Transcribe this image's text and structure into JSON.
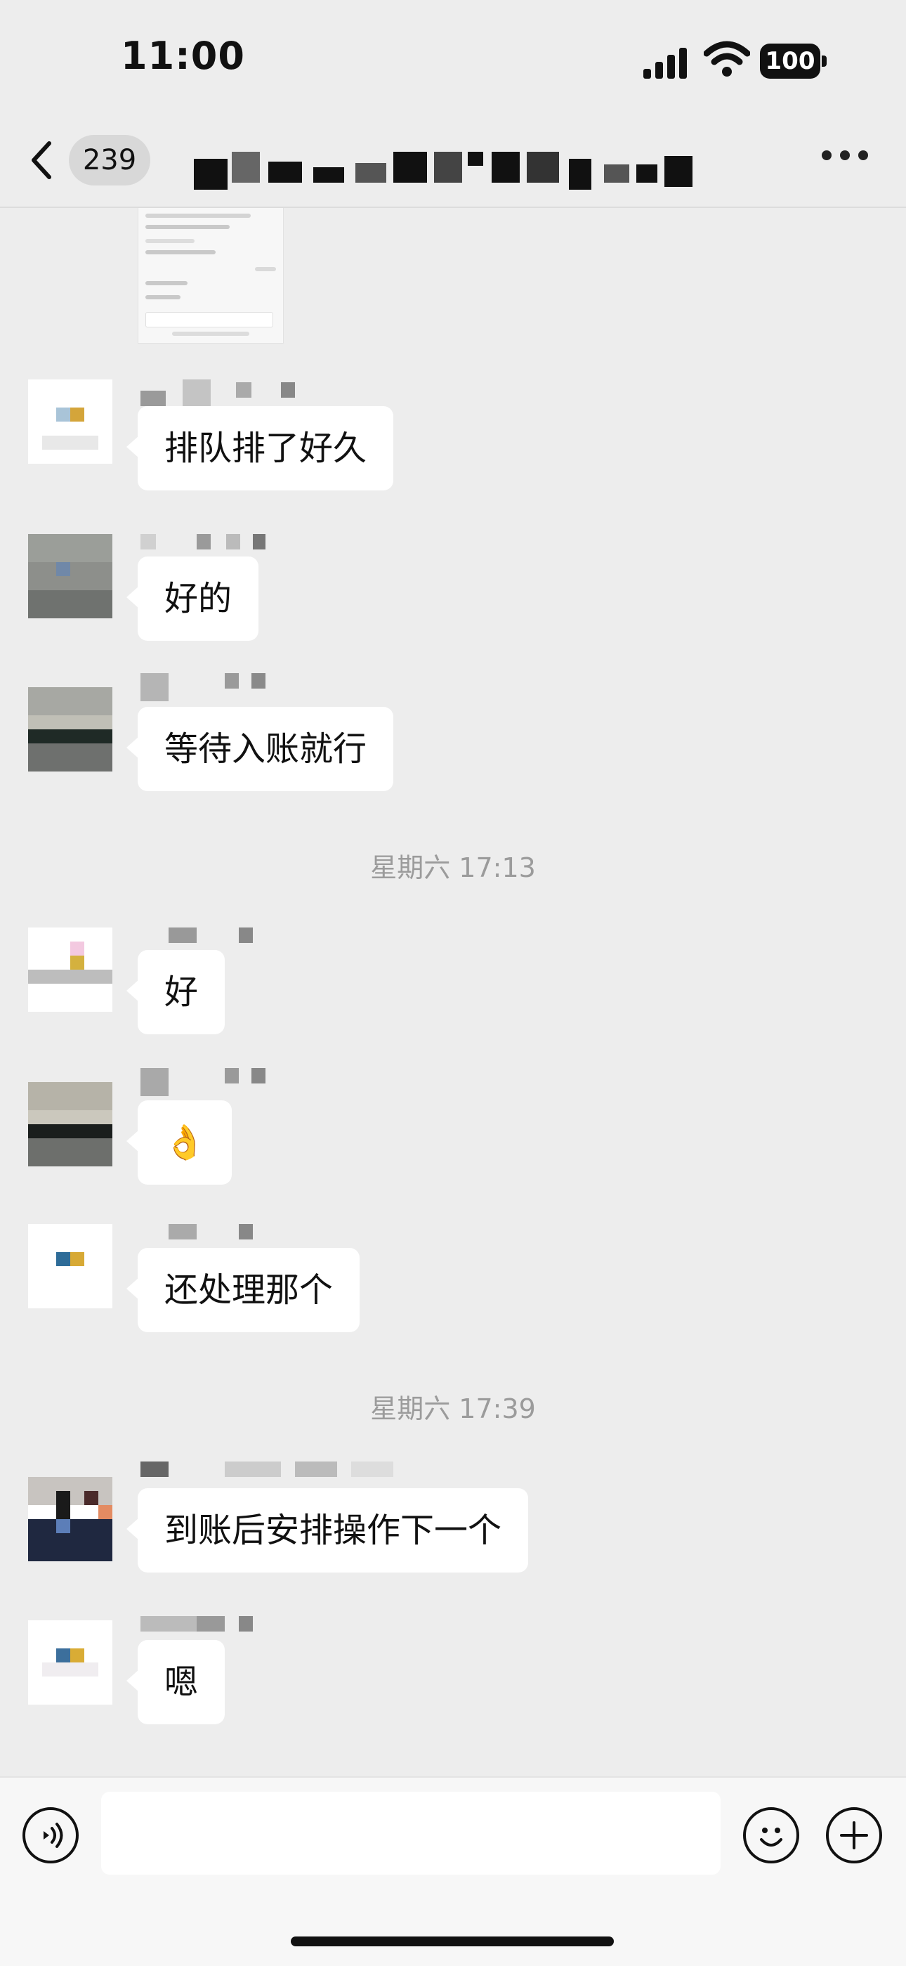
{
  "status_bar": {
    "time": "11:00",
    "battery": "100"
  },
  "nav": {
    "unread_count": "239",
    "more_icon": "more-icon",
    "back_icon": "chevron-left-icon"
  },
  "messages": [
    {
      "text": "排队排了好久"
    },
    {
      "text": "好的"
    },
    {
      "text": "等待入账就行"
    },
    {
      "text": "好"
    },
    {
      "emoji": "👌"
    },
    {
      "text": "还处理那个"
    },
    {
      "text": "到账后安排操作下一个"
    },
    {
      "text": "嗯"
    }
  ],
  "timestamps": [
    "星期六 17:13",
    "星期六 17:39"
  ],
  "input_bar": {
    "voice_icon": "voice-icon",
    "emoji_icon": "smile-icon",
    "plus_icon": "plus-icon"
  },
  "colors": {
    "background": "#EDEDED",
    "bubble": "#FFFFFF",
    "timestamp": "#9B9B9B"
  }
}
